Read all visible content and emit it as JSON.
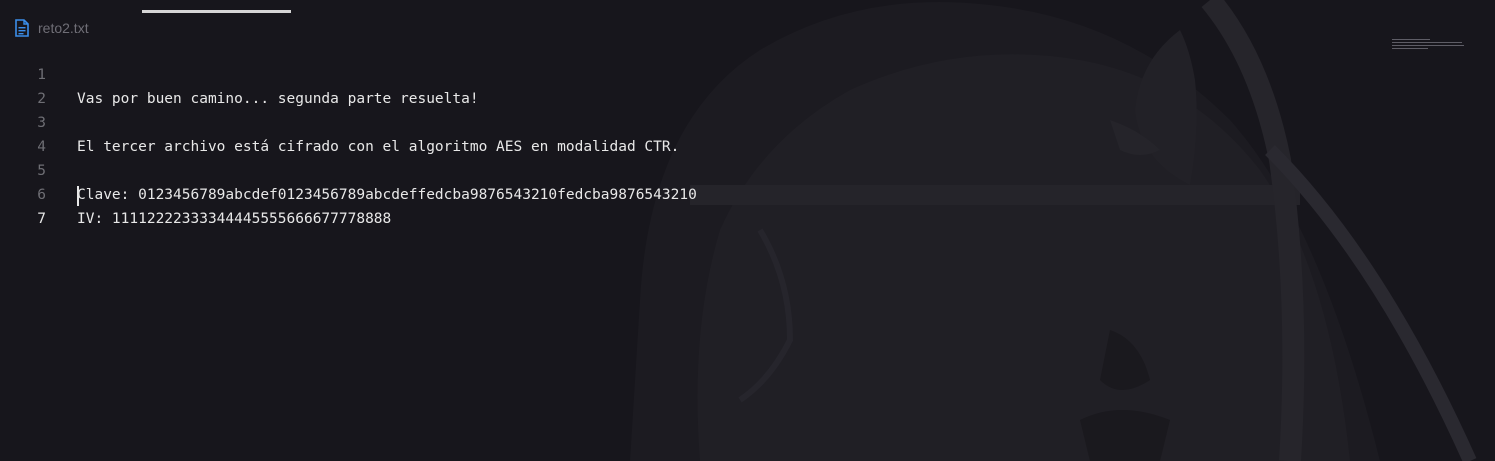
{
  "tab": {
    "file_name": "reto2.txt",
    "top_glyphs": "·· ··"
  },
  "editor": {
    "lines": [
      {
        "number": "1",
        "text": "Vas por buen camino... segunda parte resuelta!"
      },
      {
        "number": "2",
        "text": ""
      },
      {
        "number": "3",
        "text": "El tercer archivo está cifrado con el algoritmo AES en modalidad CTR."
      },
      {
        "number": "4",
        "text": ""
      },
      {
        "number": "5",
        "text": "Clave: 0123456789abcdef0123456789abcdeffedcba9876543210fedcba9876543210"
      },
      {
        "number": "6",
        "text": "IV: 11112222333344445555666677778888"
      },
      {
        "number": "7",
        "text": ""
      }
    ],
    "active_line": "7"
  },
  "icons": {
    "file": "file-text-icon"
  },
  "colors": {
    "background": "#17161c",
    "text": "#e8e8e8",
    "line_number": "#6e6e74",
    "accent": "#3b8eea"
  }
}
